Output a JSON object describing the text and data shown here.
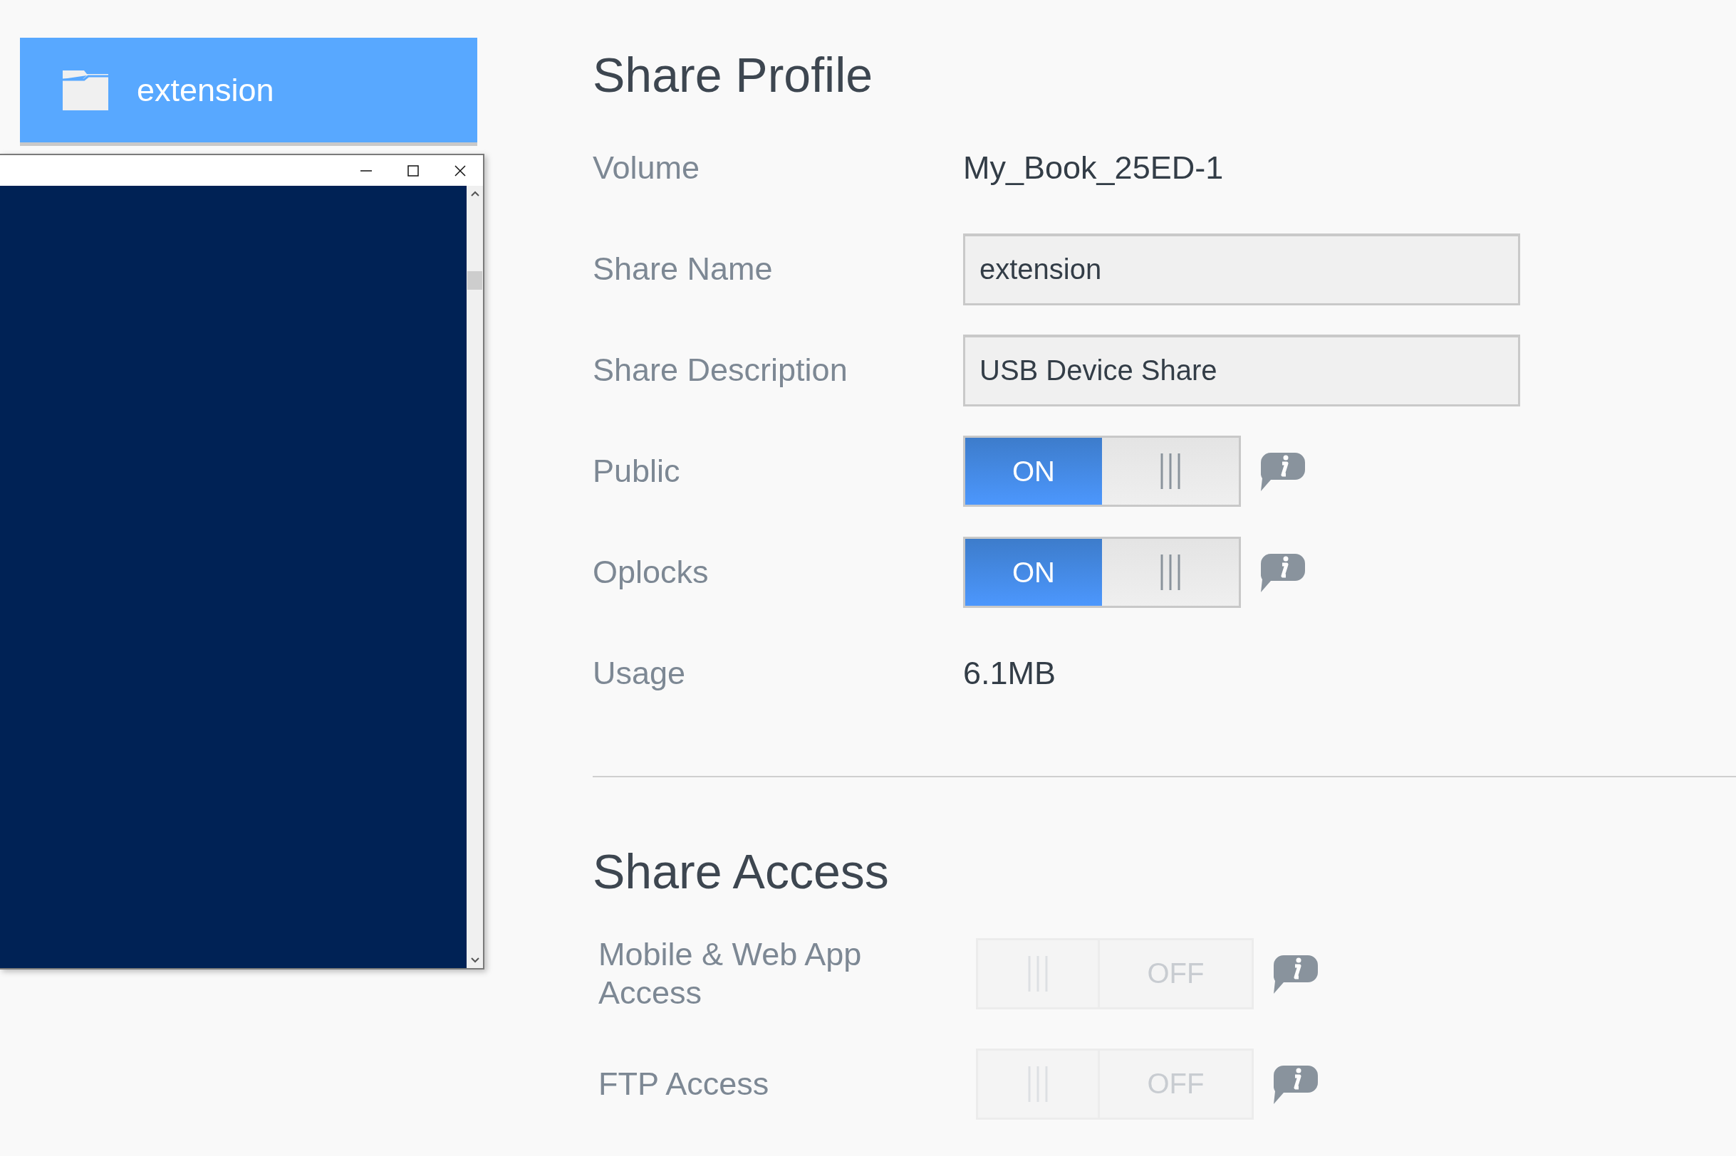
{
  "sidebar": {
    "items": [
      {
        "label": "extension",
        "selected": true
      }
    ]
  },
  "sections": [
    {
      "title": "Share Profile",
      "rows": [
        {
          "kind": "text",
          "label": "Volume",
          "value": "My_Book_25ED-1"
        },
        {
          "kind": "input",
          "label": "Share Name",
          "value": "extension"
        },
        {
          "kind": "input",
          "label": "Share Description",
          "value": "USB Device Share"
        },
        {
          "kind": "toggle",
          "label": "Public",
          "on": true,
          "disabled": false,
          "state_label": "ON"
        },
        {
          "kind": "toggle",
          "label": "Oplocks",
          "on": true,
          "disabled": false,
          "state_label": "ON"
        },
        {
          "kind": "text",
          "label": "Usage",
          "value": "6.1MB"
        }
      ]
    },
    {
      "title": "Share Access",
      "rows": [
        {
          "kind": "toggle",
          "label": "Mobile & Web App Access",
          "on": false,
          "disabled": true,
          "state_label": "OFF"
        },
        {
          "kind": "toggle",
          "label": "FTP Access",
          "on": false,
          "disabled": true,
          "state_label": "OFF"
        }
      ]
    }
  ]
}
